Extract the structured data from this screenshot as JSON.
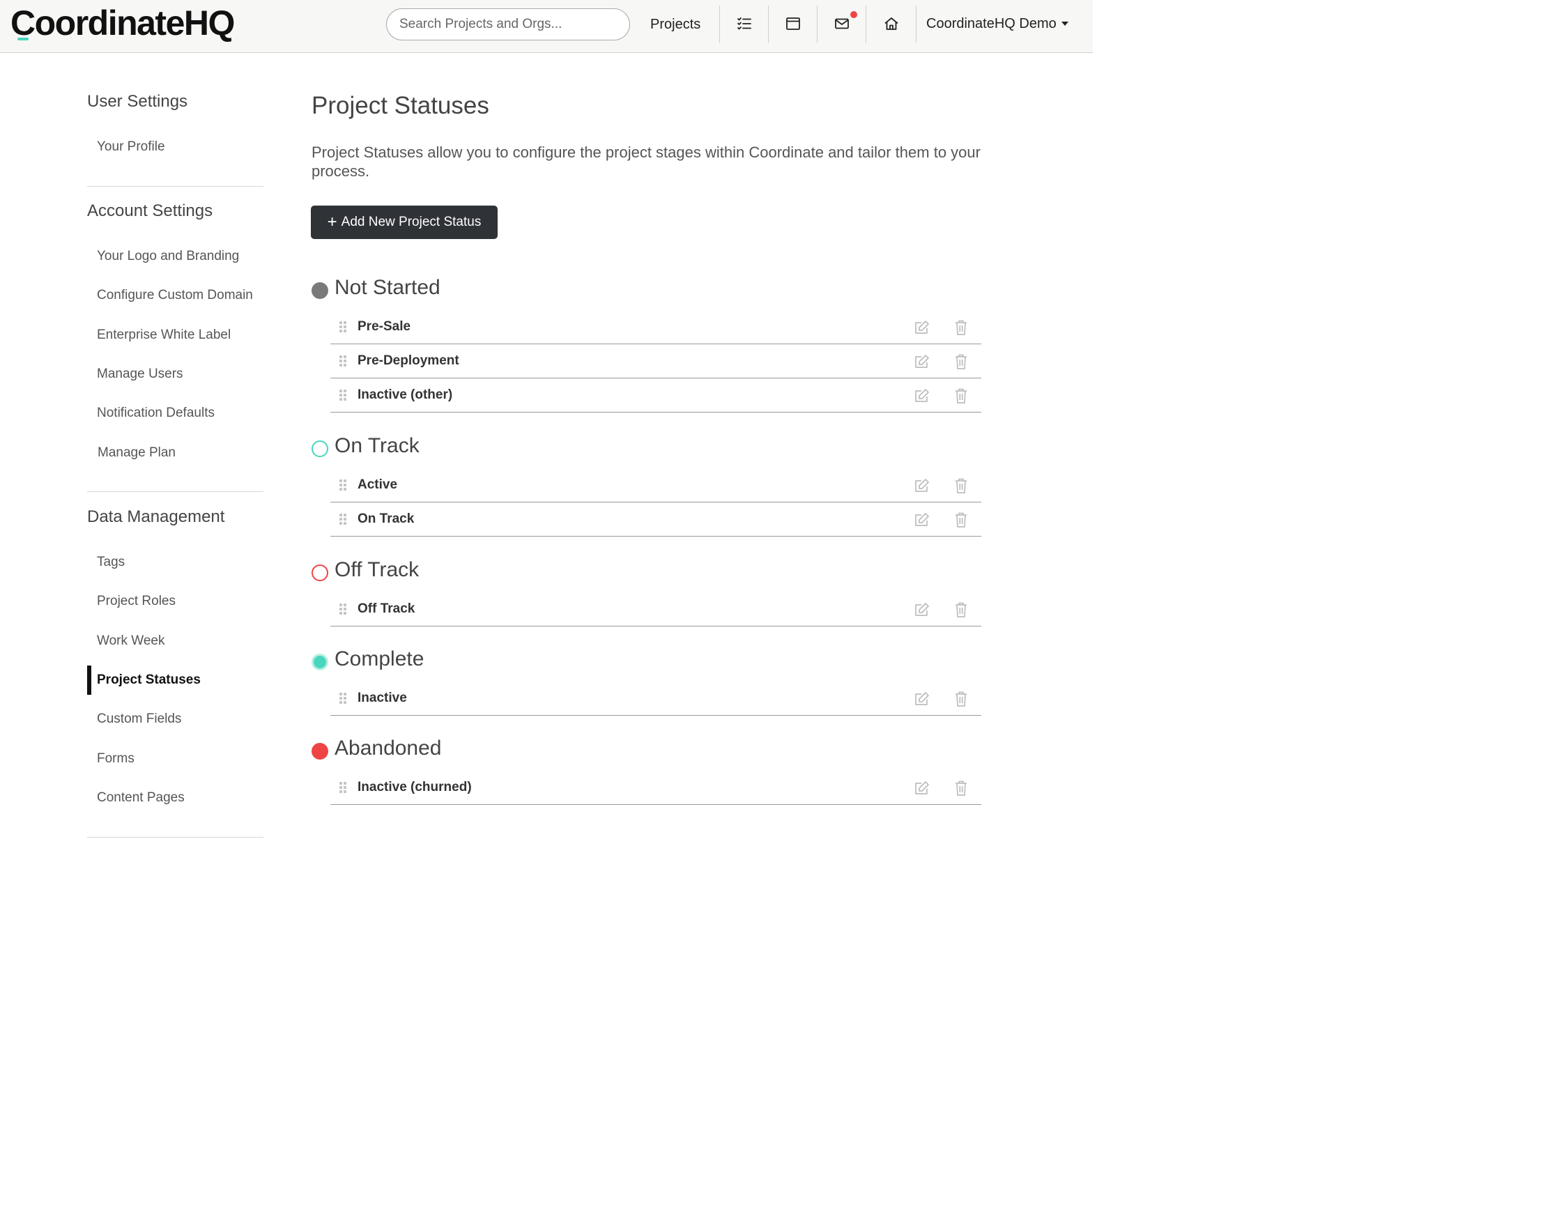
{
  "header": {
    "logo_text": "CoordinateHQ",
    "search_placeholder": "Search Projects and Orgs...",
    "projects_label": "Projects",
    "icons": [
      "checklist-icon",
      "window-icon",
      "mail-icon",
      "home-icon"
    ],
    "account_label": "CoordinateHQ Demo",
    "accent_color": "#49d6bf"
  },
  "sidebar": {
    "sections": [
      {
        "heading": "User Settings",
        "items": [
          "Your Profile"
        ]
      },
      {
        "heading": "Account Settings",
        "items": [
          "Your Logo and Branding",
          "Configure Custom Domain",
          "Enterprise White Label",
          "Manage Users",
          "Notification Defaults",
          "Manage Plan"
        ]
      },
      {
        "heading": "Data Management",
        "items": [
          "Tags",
          "Project Roles",
          "Work Week",
          "Project Statuses",
          "Custom Fields",
          "Forms",
          "Content Pages"
        ]
      }
    ],
    "active_item": "Project Statuses"
  },
  "main": {
    "title": "Project Statuses",
    "description": "Project Statuses allow you to configure the project stages within Coordinate and tailor them to your process.",
    "add_button_label": "Add New Project Status",
    "groups": [
      {
        "name": "Not Started",
        "indicator": "filled",
        "color": "#7a7a7a",
        "statuses": [
          "Pre-Sale",
          "Pre-Deployment",
          "Inactive (other)"
        ]
      },
      {
        "name": "On Track",
        "indicator": "outline",
        "color": "#49d6bf",
        "statuses": [
          "Active",
          "On Track"
        ]
      },
      {
        "name": "Off Track",
        "indicator": "outline",
        "color": "#ef4444",
        "statuses": [
          "Off Track"
        ]
      },
      {
        "name": "Complete",
        "indicator": "filled-ring",
        "color": "#49d6bf",
        "statuses": [
          "Inactive"
        ]
      },
      {
        "name": "Abandoned",
        "indicator": "filled",
        "color": "#ef4444",
        "statuses": [
          "Inactive (churned)"
        ]
      }
    ]
  }
}
